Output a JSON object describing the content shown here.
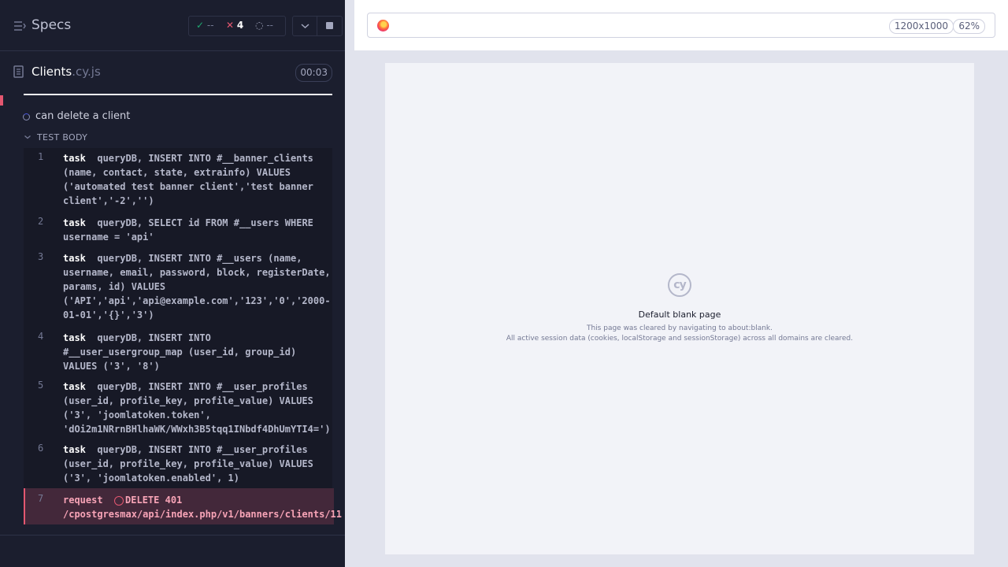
{
  "reporter": {
    "specs_label": "Specs",
    "stats": {
      "passed": "--",
      "failed": "4",
      "pending": "--"
    },
    "file": {
      "name": "Clients",
      "ext": ".cy.js",
      "duration": "00:03"
    },
    "test": {
      "title": "can delete a client",
      "section_label": "TEST BODY"
    },
    "commands": [
      {
        "num": "1",
        "name": "task",
        "message": "queryDB, INSERT INTO #__banner_clients (name, contact, state, extrainfo) VALUES ('automated test banner client','test banner client','-2','')",
        "state": "passed"
      },
      {
        "num": "2",
        "name": "task",
        "message": "queryDB, SELECT id FROM #__users WHERE username = 'api'",
        "state": "passed"
      },
      {
        "num": "3",
        "name": "task",
        "message": "queryDB, INSERT INTO #__users (name, username, email, password, block, registerDate, params, id) VALUES ('API','api','api@example.com','123','0','2000-01-01','{}','3')",
        "state": "passed"
      },
      {
        "num": "4",
        "name": "task",
        "message": "queryDB, INSERT INTO #__user_usergroup_map (user_id, group_id) VALUES ('3', '8')",
        "state": "passed"
      },
      {
        "num": "5",
        "name": "task",
        "message": "queryDB, INSERT INTO #__user_profiles (user_id, profile_key, profile_value) VALUES ('3', 'joomlatoken.token', 'dOi2m1NRrnBHlhaWK/WWxh3B5tqq1INbdf4DhUmYTI4=')",
        "state": "passed"
      },
      {
        "num": "6",
        "name": "task",
        "message": "queryDB, INSERT INTO #__user_profiles (user_id, profile_key, profile_value) VALUES ('3', 'joomlatoken.enabled', 1)",
        "state": "passed"
      },
      {
        "num": "7",
        "name": "request",
        "message": "DELETE 401 /cpostgresmax/api/index.php/v1/banners/clients/11",
        "state": "failed"
      }
    ]
  },
  "aut": {
    "viewport": "1200x1000",
    "zoom": "62%",
    "logo_text": "cy",
    "blank_title": "Default blank page",
    "blank_line1": "This page was cleared by navigating to about:blank.",
    "blank_line2": "All active session data (cookies, localStorage and sessionStorage) across all domains are cleared."
  },
  "colors": {
    "panel_bg": "#1b1e2e",
    "passed": "#1fa971",
    "failed": "#e45770",
    "running": "#4956e3"
  },
  "icons": [
    "specs-menu-icon",
    "check-icon",
    "x-icon",
    "pending-spinner-icon",
    "chevron-down-icon",
    "stop-icon",
    "file-icon",
    "spinner-icon",
    "firefox-icon",
    "cypress-logo"
  ]
}
